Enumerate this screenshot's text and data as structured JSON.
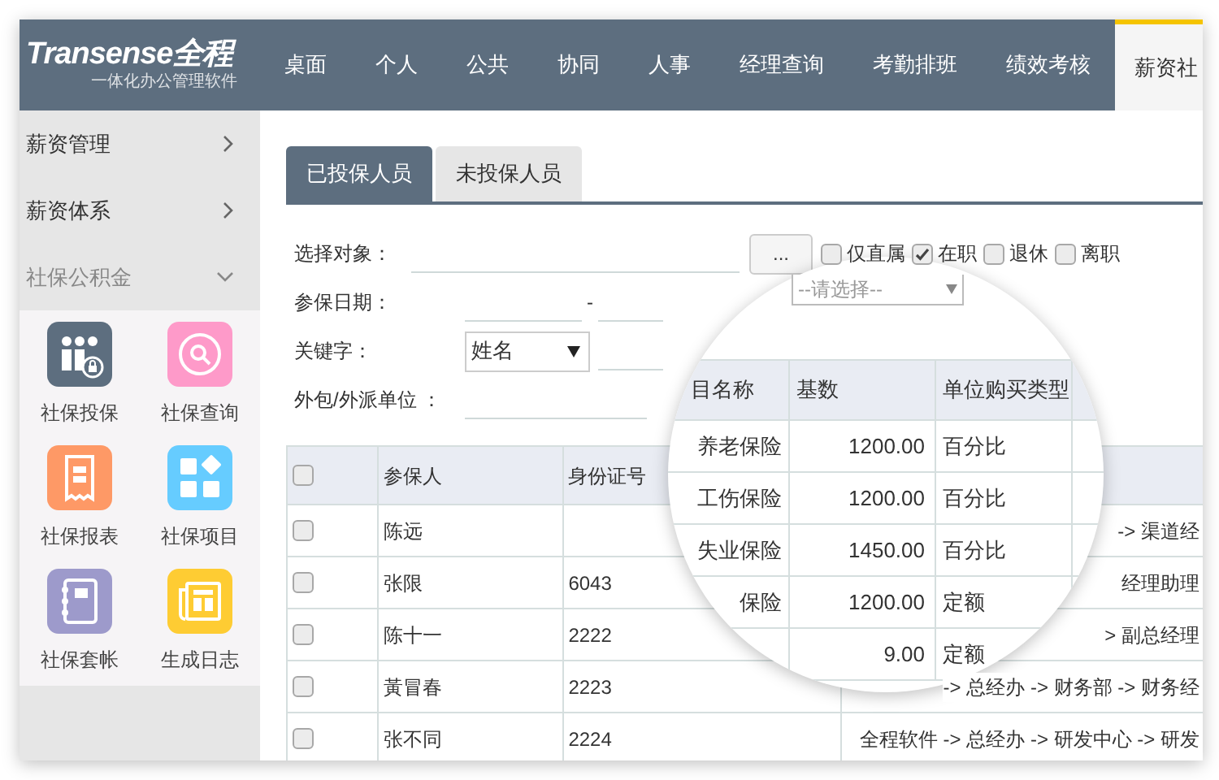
{
  "header": {
    "logo": {
      "brand": "Transense全程",
      "tagline": "一体化办公管理软件"
    },
    "nav": [
      {
        "label": "桌面",
        "selected": false
      },
      {
        "label": "个人",
        "selected": false
      },
      {
        "label": "公共",
        "selected": false
      },
      {
        "label": "协同",
        "selected": false
      },
      {
        "label": "人事",
        "selected": false
      },
      {
        "label": "经理查询",
        "selected": false
      },
      {
        "label": "考勤排班",
        "selected": false
      },
      {
        "label": "绩效考核",
        "selected": false
      },
      {
        "label": "薪资社",
        "selected": true
      }
    ]
  },
  "sidebar": {
    "items": [
      {
        "label": "薪资管理",
        "expanded": false
      },
      {
        "label": "薪资体系",
        "expanded": false
      },
      {
        "label": "社保公积金",
        "expanded": true
      }
    ],
    "apps": [
      {
        "label": "社保投保",
        "color": "#5d6e7f"
      },
      {
        "label": "社保查询",
        "color": "#fe9ac9"
      },
      {
        "label": "社保报表",
        "color": "#fe9966"
      },
      {
        "label": "社保项目",
        "color": "#66ccff"
      },
      {
        "label": "社保套帐",
        "color": "#9d9acb"
      },
      {
        "label": "生成日志",
        "color": "#fecc33"
      }
    ]
  },
  "tabs": [
    {
      "label": "已投保人员",
      "selected": true
    },
    {
      "label": "未投保人员",
      "selected": false
    }
  ],
  "form": {
    "select_object": {
      "label": "选择对象：",
      "button": "..."
    },
    "filters": [
      {
        "label": "仅直属",
        "checked": false
      },
      {
        "label": "在职",
        "checked": true
      },
      {
        "label": "退休",
        "checked": false
      },
      {
        "label": "离职",
        "checked": false
      }
    ],
    "date": {
      "label": "参保日期：",
      "separator": "-"
    },
    "dropdown": {
      "placeholder": "--请选择--"
    },
    "keyword": {
      "label": "关键字：",
      "select": "姓名"
    },
    "outsource": {
      "label": "外包/外派单位 ："
    }
  },
  "table": {
    "header_checked": false,
    "columns": [
      "参保人",
      "身份证号"
    ],
    "rows": [
      {
        "checked": false,
        "name": "陈远",
        "column_4": "-> 渠道经"
      },
      {
        "checked": false,
        "name": "张限",
        "id": "6043",
        "column_4": "经理助理"
      },
      {
        "checked": false,
        "name": "陈十一",
        "id": "2222",
        "column_4": "> 副总经理"
      },
      {
        "checked": false,
        "name": "黃冒春",
        "id": "2223",
        "column_4": "-> 总经办 -> 财务部 -> 财务经"
      },
      {
        "checked": false,
        "name": "张不同",
        "id": "2224",
        "column_4": "全程软件 -> 总经办 -> 研发中心 -> 研发"
      }
    ]
  },
  "magnifier": {
    "columns": [
      "目名称",
      "基数",
      "单位购买类型"
    ],
    "rows": [
      {
        "name": "养老保险",
        "base": "1200.00",
        "type": "百分比"
      },
      {
        "name": "工伤保险",
        "base": "1200.00",
        "type": "百分比"
      },
      {
        "name": "失业保险",
        "base": "1450.00",
        "type": "百分比"
      },
      {
        "name": "保险",
        "base": "1200.00",
        "type": "定额"
      },
      {
        "base": "9.00",
        "type": "定额"
      }
    ]
  }
}
